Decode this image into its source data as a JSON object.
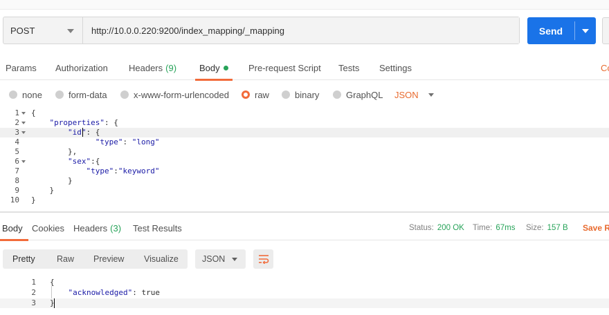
{
  "request": {
    "method": "POST",
    "url": "http://10.0.0.220:9200/index_mapping/_mapping",
    "send_label": "Send"
  },
  "request_tabs": {
    "params": "Params",
    "authorization": "Authorization",
    "headers": "Headers",
    "headers_count": "(9)",
    "body": "Body",
    "prerequest": "Pre-request Script",
    "tests": "Tests",
    "settings": "Settings",
    "cookies_partial": "Co"
  },
  "body_types": {
    "none": "none",
    "form_data": "form-data",
    "urlencoded": "x-www-form-urlencoded",
    "raw": "raw",
    "binary": "binary",
    "graphql": "GraphQL",
    "format": "JSON",
    "selected": "raw"
  },
  "editor": {
    "line_numbers": [
      "1",
      "2",
      "3",
      "4",
      "5",
      "6",
      "7",
      "8",
      "9",
      "10"
    ],
    "lines": [
      "{",
      "    \"properties\": {",
      "        \"id\": {",
      "              \"type\": \"long\"",
      "        },",
      "        \"sex\":{",
      "            \"type\":\"keyword\"",
      "        }",
      "    }",
      "}"
    ]
  },
  "response_tabs": {
    "body": "Body",
    "cookies": "Cookies",
    "headers": "Headers",
    "headers_count": "(3)",
    "test_results": "Test Results",
    "status_label": "Status:",
    "status_value": "200 OK",
    "time_label": "Time:",
    "time_value": "67ms",
    "size_label": "Size:",
    "size_value": "157 B",
    "save_partial": "Save R"
  },
  "response_view": {
    "pretty": "Pretty",
    "raw": "Raw",
    "preview": "Preview",
    "visualize": "Visualize",
    "format": "JSON"
  },
  "response_body": {
    "line_numbers": [
      "1",
      "2",
      "3"
    ],
    "lines": [
      "{",
      "    \"acknowledged\": true",
      "}"
    ]
  },
  "colors": {
    "accent": "#f26b3a",
    "send_button": "#1a73e8",
    "success": "#27a359"
  },
  "icons": {
    "wrap": "wrap-lines-icon"
  }
}
